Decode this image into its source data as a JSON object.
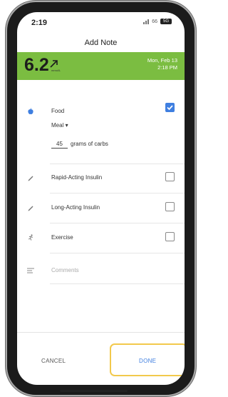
{
  "status_bar": {
    "time": "2:19",
    "network": "66",
    "battery": "5G"
  },
  "header": {
    "title": "Add Note"
  },
  "reading": {
    "value": "6.2",
    "trend": "up-right-arrow",
    "unit": "mmol/L",
    "date": "Mon, Feb 13",
    "time": "2:18 PM",
    "color": "#7bbd41"
  },
  "food": {
    "label": "Food",
    "checked": true,
    "meal": "Meal ▾",
    "grams": "45",
    "grams_label": "grams of carbs"
  },
  "items": {
    "rapid": "Rapid-Acting Insulin",
    "long": "Long-Acting Insulin",
    "exercise": "Exercise"
  },
  "comments": {
    "placeholder": "Comments"
  },
  "footer": {
    "cancel": "CANCEL",
    "done": "DONE"
  },
  "colors": {
    "accent": "#3f7fe0",
    "highlight": "#f2c94c"
  }
}
